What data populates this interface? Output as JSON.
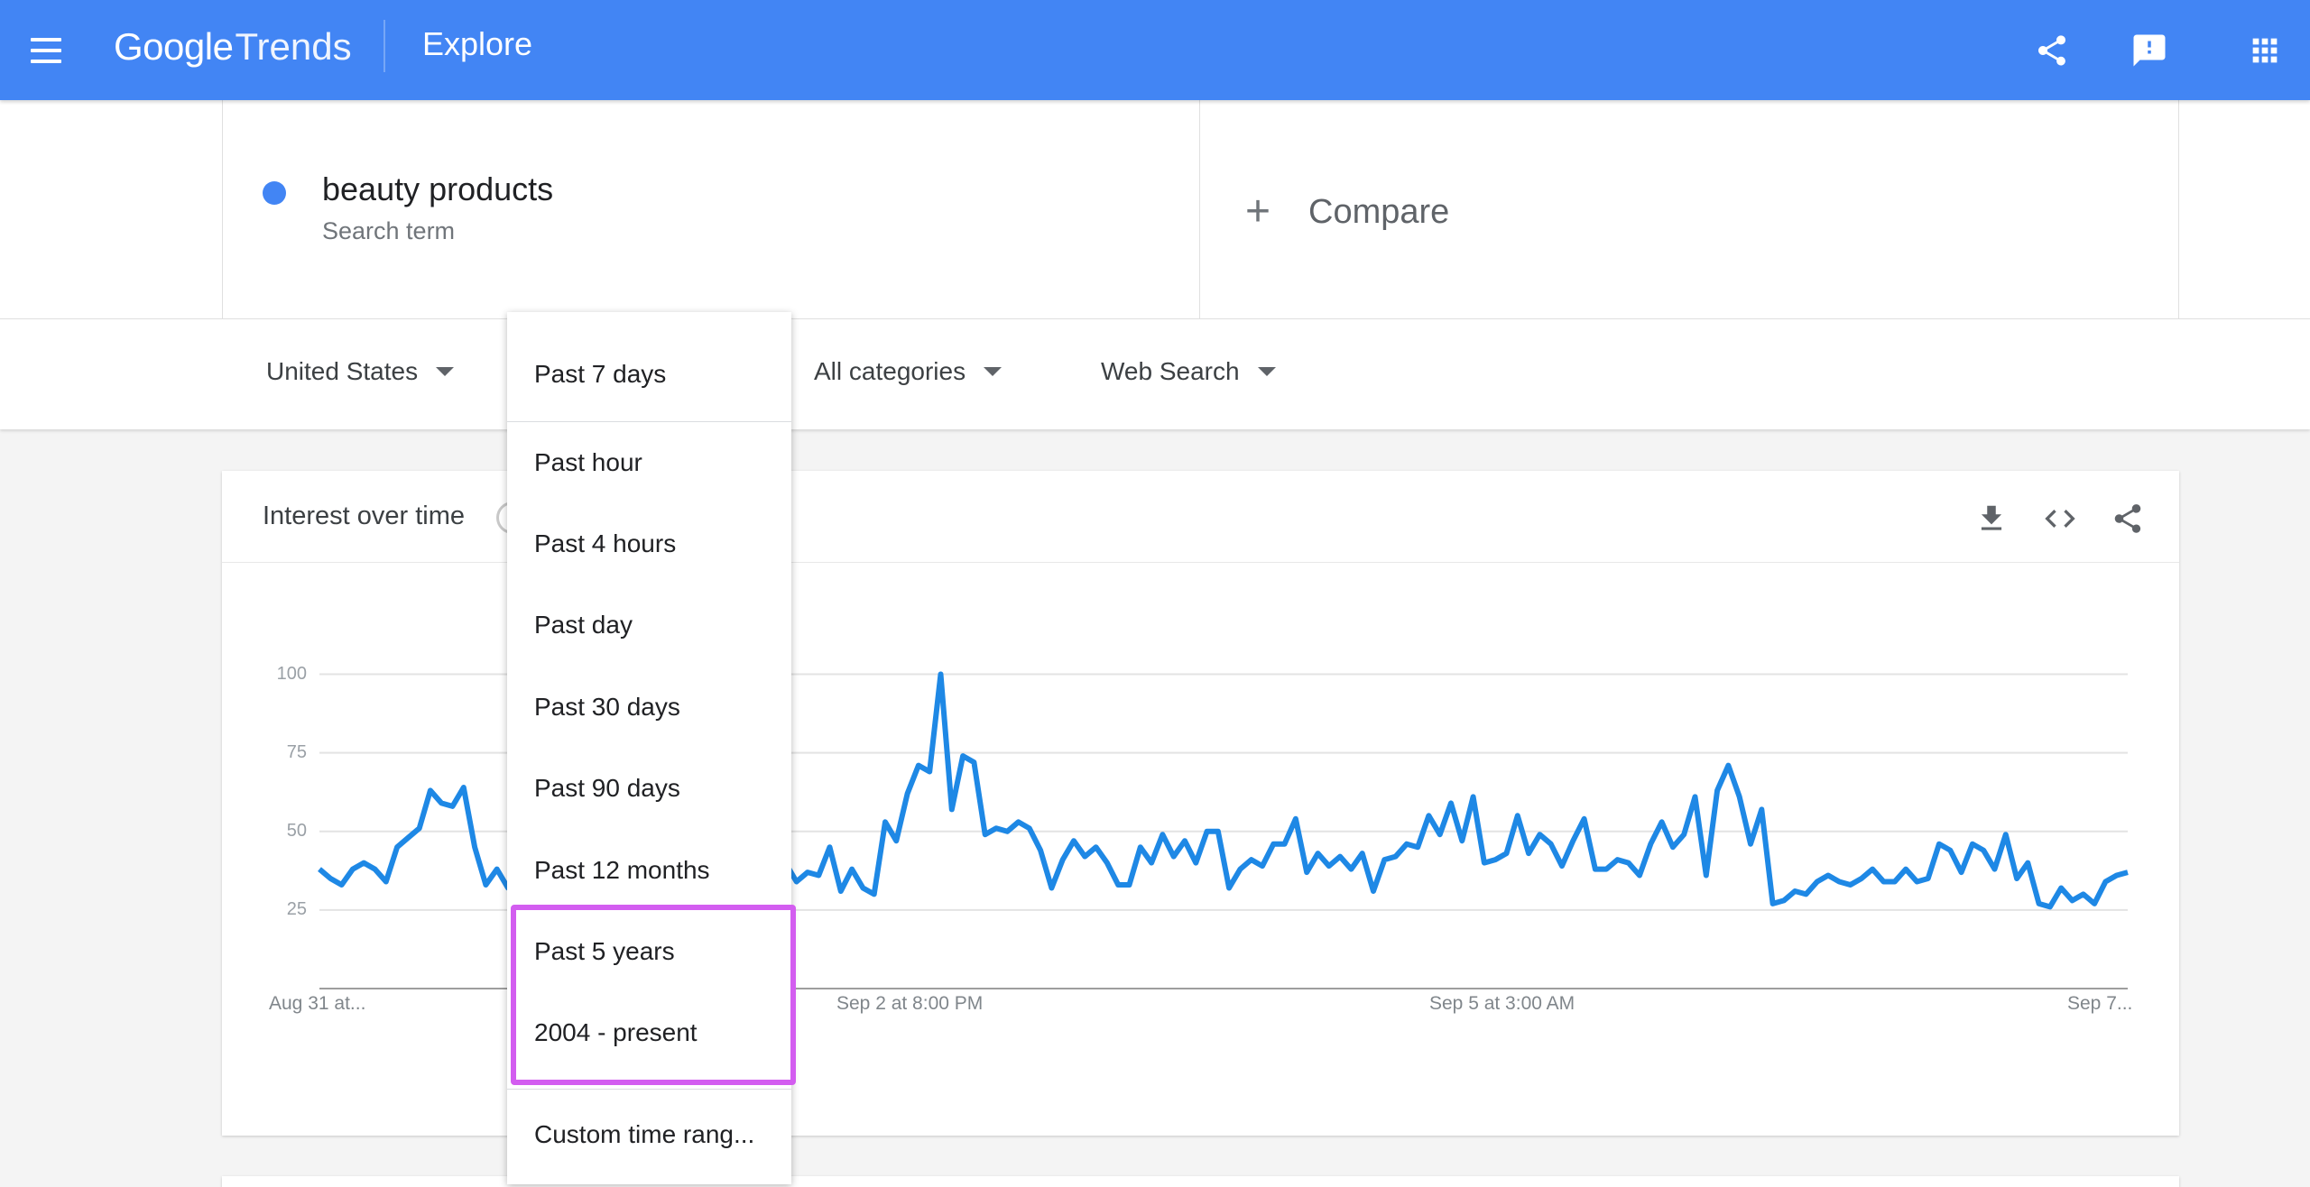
{
  "header": {
    "logo_google": "Google",
    "logo_trends": "Trends",
    "title": "Explore",
    "icons": [
      "menu-icon",
      "share-icon",
      "feedback-icon",
      "apps-icon"
    ]
  },
  "search_term": {
    "name": "beauty products",
    "type": "Search term",
    "color": "#4285f4"
  },
  "compare": {
    "label": "Compare"
  },
  "filters": {
    "region": "United States",
    "time": "Past 7 days",
    "category": "All categories",
    "property": "Web Search"
  },
  "time_menu": {
    "selected": "Past 7 days",
    "items": [
      "Past hour",
      "Past 4 hours",
      "Past day",
      "Past 30 days",
      "Past 90 days",
      "Past 12 months",
      "Past 5 years",
      "2004 - present"
    ],
    "custom": "Custom time rang...",
    "highlight_color": "#d35df0"
  },
  "card": {
    "title": "Interest over time",
    "icons": [
      "download-icon",
      "embed-icon",
      "share-icon"
    ]
  },
  "chart_data": {
    "type": "line",
    "title": "",
    "xlabel": "",
    "ylabel": "",
    "ylim": [
      0,
      100
    ],
    "yticks": [
      "100",
      "75",
      "50",
      "25"
    ],
    "xtick_labels": [
      "Aug 31 at...",
      "Sep 2 at 8:00 PM",
      "Sep 5 at 3:00 AM",
      "Sep 7..."
    ],
    "grid": true,
    "legend": "none",
    "series": [
      {
        "color": "#1e88e5",
        "values": [
          38,
          35,
          33,
          38,
          40,
          38,
          34,
          45,
          48,
          51,
          63,
          59,
          58,
          64,
          45,
          33,
          38,
          32,
          33,
          36,
          35,
          38,
          40,
          37,
          36,
          38,
          41,
          40,
          35,
          32,
          37,
          39,
          42,
          36,
          33,
          38,
          35,
          36,
          41,
          38,
          38,
          39,
          40,
          34,
          37,
          36,
          45,
          31,
          38,
          32,
          30,
          53,
          47,
          62,
          71,
          69,
          100,
          57,
          74,
          72,
          49,
          51,
          50,
          53,
          51,
          44,
          32,
          41,
          47,
          42,
          45,
          40,
          33,
          33,
          45,
          40,
          49,
          42,
          47,
          40,
          50,
          50,
          32,
          38,
          41,
          39,
          46,
          46,
          54,
          37,
          43,
          39,
          42,
          38,
          43,
          31,
          41,
          42,
          46,
          45,
          55,
          49,
          59,
          47,
          61,
          40,
          41,
          43,
          55,
          43,
          49,
          46,
          39,
          47,
          54,
          38,
          38,
          41,
          40,
          36,
          46,
          53,
          45,
          49,
          61,
          36,
          63,
          71,
          61,
          46,
          57,
          27,
          28,
          31,
          30,
          34,
          36,
          34,
          33,
          35,
          38,
          34,
          34,
          38,
          34,
          35,
          46,
          44,
          37,
          46,
          44,
          38,
          49,
          35,
          40,
          27,
          26,
          32,
          28,
          30,
          27,
          34,
          36,
          37
        ]
      }
    ]
  }
}
